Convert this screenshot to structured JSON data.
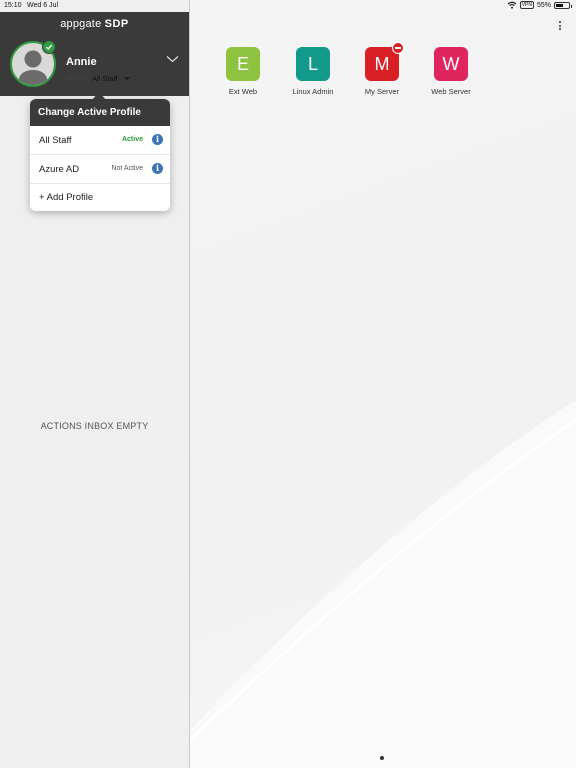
{
  "status_bar": {
    "time": "15:10",
    "date": "Wed 6 Jul",
    "vpn": "VPN",
    "battery": "55%",
    "battery_level": 0.55
  },
  "sidebar": {
    "brand_light": "appgate",
    "brand_bold": "SDP",
    "user_name": "Annie",
    "profile_label": "Profile:",
    "profile_value": "All Staff",
    "inbox_empty": "ACTIONS INBOX EMPTY"
  },
  "popover": {
    "title": "Change Active Profile",
    "profiles": [
      {
        "name": "All Staff",
        "state": "Active"
      },
      {
        "name": "Azure AD",
        "state": "Not Active"
      }
    ],
    "add_label": "+ Add Profile"
  },
  "apps": [
    {
      "letter": "E",
      "label": "Ext Web",
      "color": "#8dc33f"
    },
    {
      "letter": "L",
      "label": "Linux Admin",
      "color": "#129a8a"
    },
    {
      "letter": "M",
      "label": "My Server",
      "color": "#d81f26"
    },
    {
      "letter": "W",
      "label": "Web Server",
      "color": "#e0245e"
    }
  ],
  "colors": {
    "header": "#3a3a3a",
    "active_green": "#2f9a3f",
    "info_blue": "#3d74b6"
  }
}
